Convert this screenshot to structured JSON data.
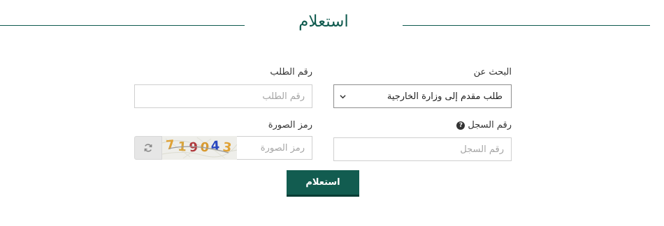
{
  "header": {
    "title": "استعلام"
  },
  "search_by": {
    "label": "البحث عن",
    "selected": "طلب مقدم إلى وزارة الخارجية"
  },
  "request_number": {
    "label": "رقم الطلب",
    "placeholder": "رقم الطلب"
  },
  "registry_number": {
    "label": "رقم السجل",
    "placeholder": "رقم السجل"
  },
  "captcha": {
    "label": "رمز الصورة",
    "placeholder": "رمز الصورة",
    "code": "719043"
  },
  "submit": {
    "label": "استعلام"
  },
  "colors": {
    "primary": "#125c50",
    "line": "#0f5a4e"
  },
  "icons": {
    "help": "question-circle-icon",
    "refresh": "refresh-icon",
    "select": "chevron-down-icon"
  }
}
